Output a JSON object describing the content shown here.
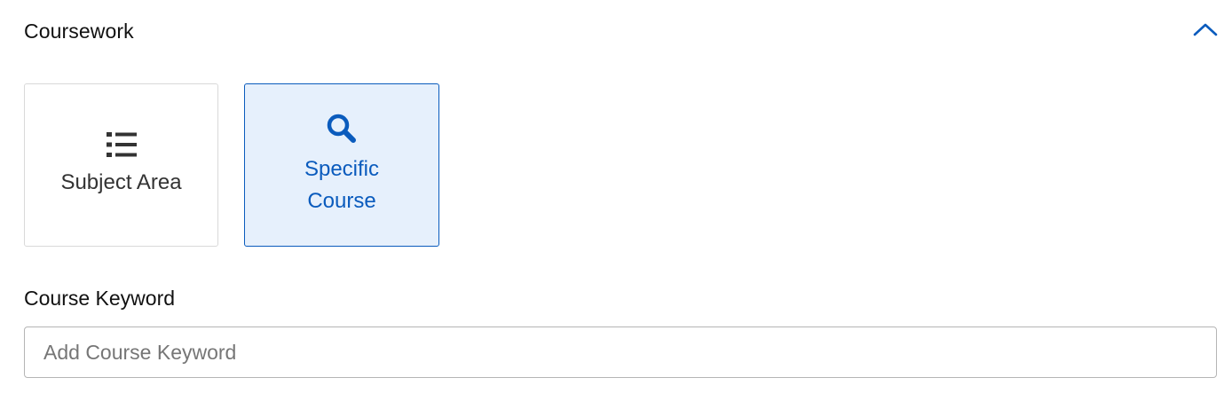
{
  "section": {
    "title": "Coursework",
    "collapse_icon": "chevron-up-icon",
    "expanded": true
  },
  "cards": [
    {
      "label": "Subject Area",
      "icon": "list-icon",
      "selected": false
    },
    {
      "label": "Specific Course",
      "icon": "search-icon",
      "selected": true
    }
  ],
  "keyword": {
    "label": "Course Keyword",
    "value": "",
    "placeholder": "Add Course Keyword"
  },
  "colors": {
    "accent": "#0a5bbd",
    "selected_bg": "#e6f0fc",
    "border": "#d9d9d9",
    "text": "#333333"
  }
}
